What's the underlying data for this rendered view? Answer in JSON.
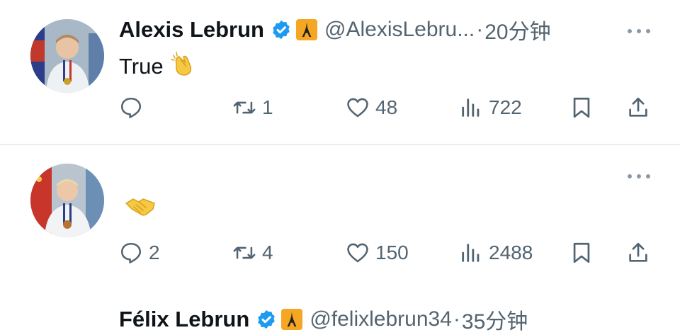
{
  "tweets": [
    {
      "name": "Alexis Lebrun",
      "handle": "@AlexisLebru...",
      "separator": "·",
      "time": "20分钟",
      "text": "True",
      "emoji": "clapping-hands",
      "reply_count": "",
      "retweet_count": "1",
      "like_count": "48",
      "view_count": "722"
    },
    {
      "name": "Félix Lebrun",
      "handle": "@felixlebrun34",
      "separator": "·",
      "time": "35分钟",
      "text": "",
      "emoji": "handshake",
      "reply_count": "2",
      "retweet_count": "4",
      "like_count": "150",
      "view_count": "2488"
    }
  ],
  "colors": {
    "verified": "#1d9bf0",
    "badge": "#f5a623",
    "muted": "#536471",
    "text": "#0f1419"
  },
  "icons": [
    "reply-icon",
    "retweet-icon",
    "like-icon",
    "views-icon",
    "bookmark-icon",
    "share-icon",
    "more-icon",
    "verified-icon",
    "eiffel-tower-icon"
  ]
}
